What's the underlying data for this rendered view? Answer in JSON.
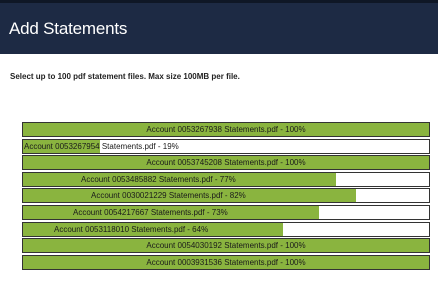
{
  "dialog": {
    "title": "Add Statements",
    "instructions": "Select up to 100 pdf statement files. Max size 100MB per file."
  },
  "colors": {
    "header_bg": "#1d2a44",
    "progress_fill": "#8ab43f",
    "row_border": "#333333"
  },
  "files": [
    {
      "label": "Account 0053267938 Statements.pdf - 100%",
      "progress": 100
    },
    {
      "label": "Account 0053267954 Statements.pdf - 19%",
      "progress": 19
    },
    {
      "label": "Account 0053745208 Statements.pdf - 100%",
      "progress": 100
    },
    {
      "label": "Account 0053485882 Statements.pdf - 77%",
      "progress": 77
    },
    {
      "label": "Account 0030021229 Statements.pdf - 82%",
      "progress": 82
    },
    {
      "label": "Account 0054217667 Statements.pdf - 73%",
      "progress": 73
    },
    {
      "label": "Account 0053118010 Statements.pdf - 64%",
      "progress": 64
    },
    {
      "label": "Account 0054030192 Statements.pdf - 100%",
      "progress": 100
    },
    {
      "label": "Account 0003931536 Statements.pdf - 100%",
      "progress": 100
    }
  ]
}
